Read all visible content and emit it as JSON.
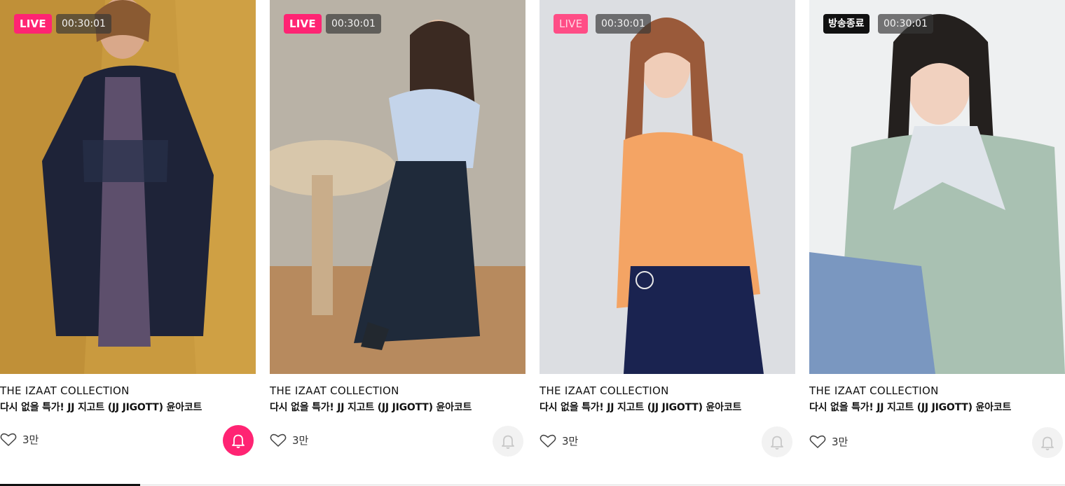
{
  "cards": [
    {
      "status": "LIVE",
      "timer": "00:30:01",
      "brand": "THE IZAAT COLLECTION",
      "title": "다시 없을 특가! JJ 지고트 (JJ JIGOTT) 윤아코트",
      "likes": "3만",
      "alarm_on": true
    },
    {
      "status": "LIVE",
      "timer": "00:30:01",
      "brand": "THE IZAAT COLLECTION",
      "title": "다시 없을 특가! JJ 지고트 (JJ JIGOTT) 윤아코트",
      "likes": "3만",
      "alarm_on": false
    },
    {
      "status": "LIVE",
      "timer": "00:30:01",
      "brand": "THE IZAAT COLLECTION",
      "title": "다시 없을 특가! JJ 지고트 (JJ JIGOTT) 윤아코트",
      "likes": "3만",
      "alarm_on": false
    },
    {
      "status": "방송종료",
      "timer": "00:30:01",
      "brand": "THE IZAAT COLLECTION",
      "title": "다시 없을 특가! JJ 지고트 (JJ JIGOTT) 윤아코트",
      "likes": "3만",
      "alarm_on": false
    }
  ],
  "colors": {
    "live_badge": "#ff2473",
    "ended_badge": "#111111",
    "alarm_active": "#ff2473",
    "alarm_inactive": "#f2f2f2"
  },
  "icons": {
    "like": "heart-icon",
    "alarm": "bell-icon"
  }
}
